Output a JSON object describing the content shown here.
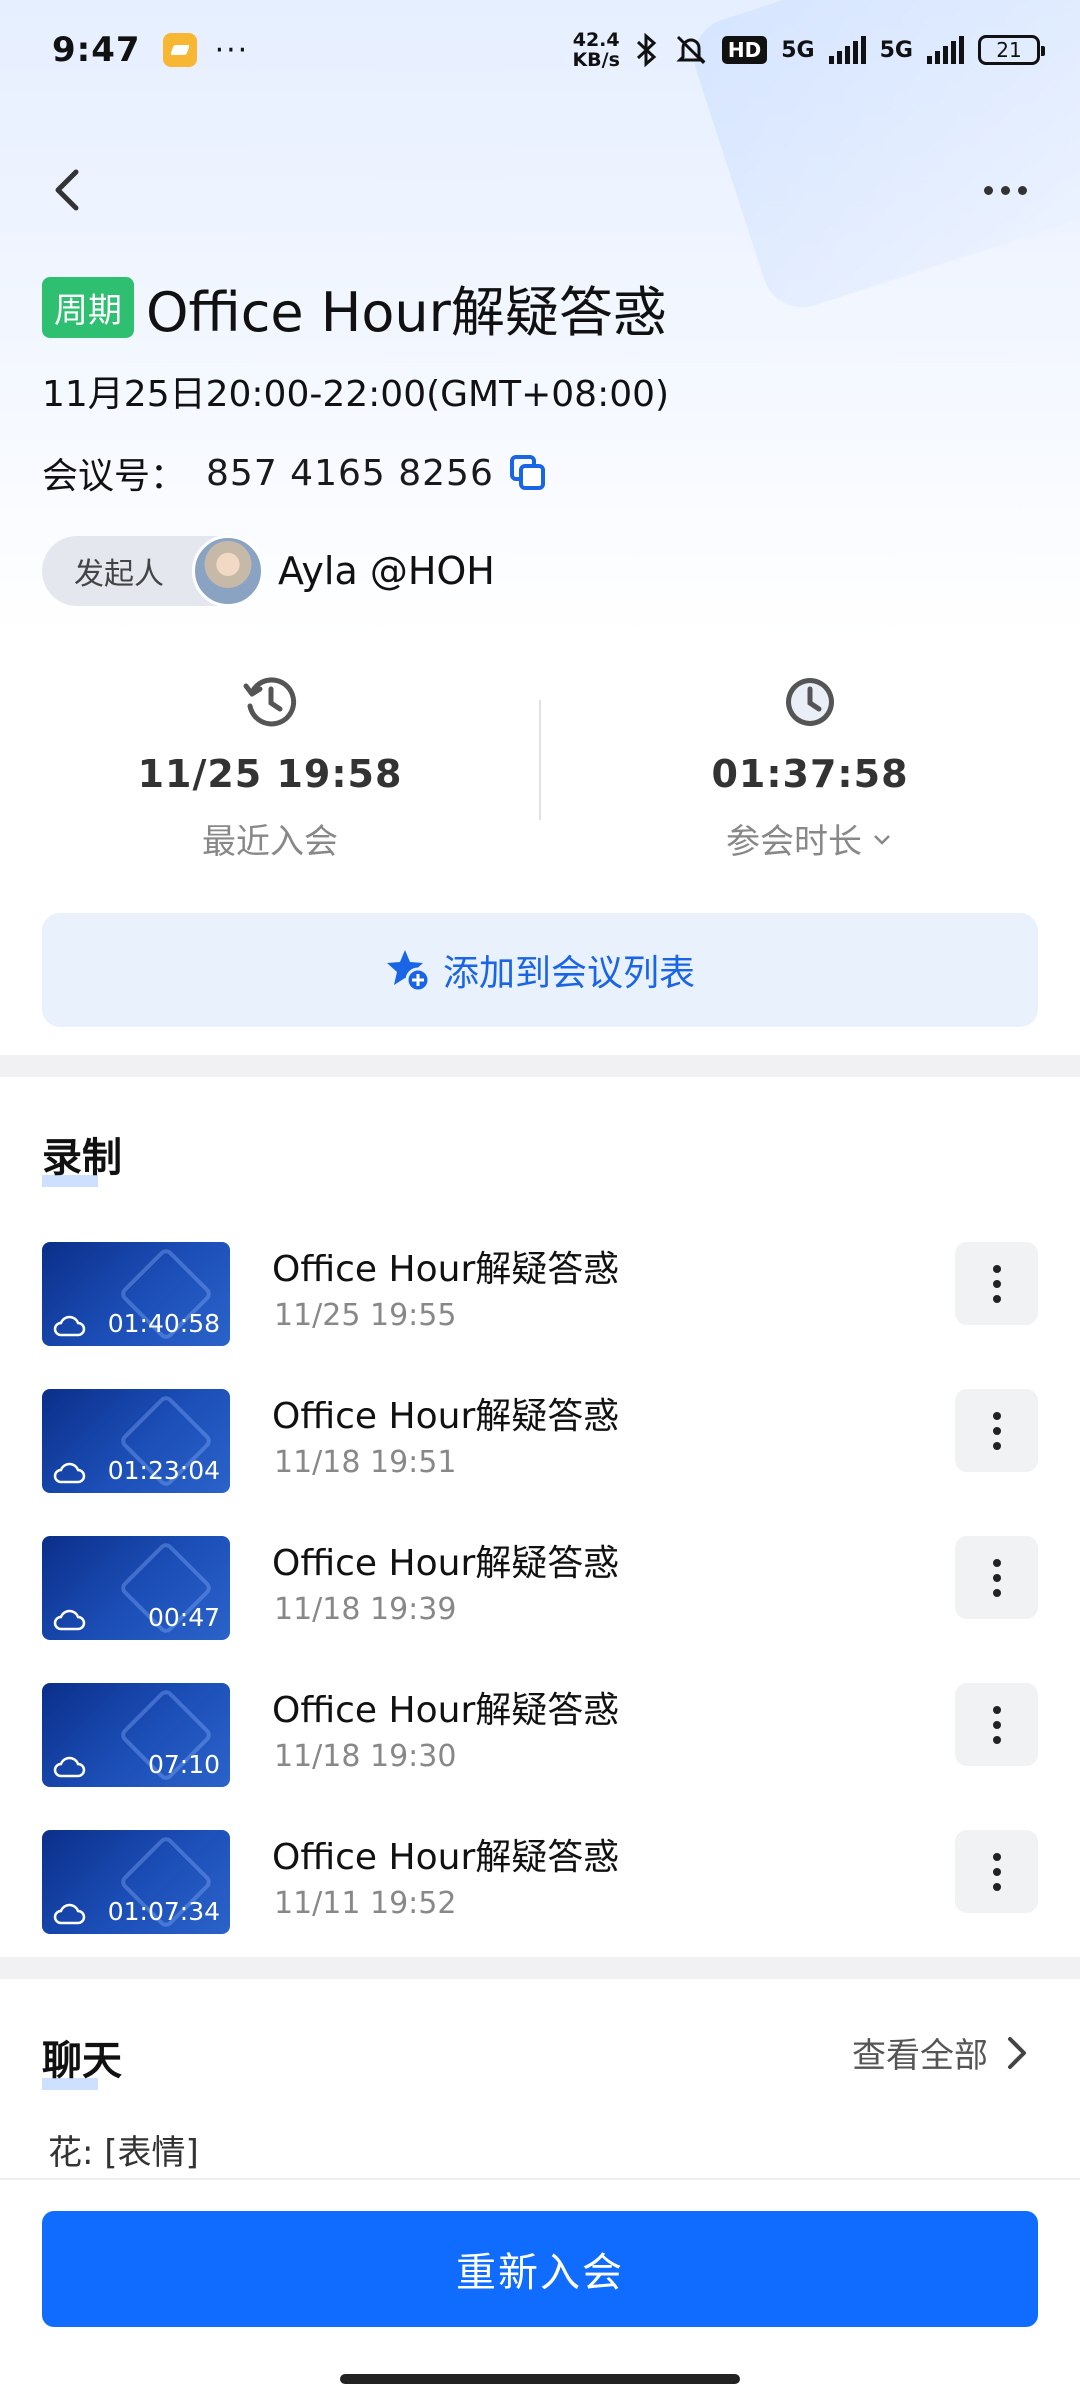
{
  "status": {
    "time": "9:47",
    "dots": "···",
    "speed_value": "42.4",
    "speed_unit": "KB/s",
    "hd": "HD",
    "net1": "5G",
    "net2": "5G",
    "battery": "21"
  },
  "header": {
    "tag": "周期",
    "title": "Office Hour解疑答惑",
    "time_range": "11月25日20:00-22:00(GMT+08:00)",
    "meeting_label": "会议号：",
    "meeting_number": "857 4165 8256",
    "host_label": "发起人",
    "host_name": "Ayla @HOH"
  },
  "stats": {
    "recent_value": "11/25 19:58",
    "recent_label": "最近入会",
    "duration_value": "01:37:58",
    "duration_label": "参会时长"
  },
  "add_button": "添加到会议列表",
  "recordings": {
    "title": "录制",
    "items": [
      {
        "title": "Office Hour解疑答惑",
        "date": "11/25 19:55",
        "duration": "01:40:58"
      },
      {
        "title": "Office Hour解疑答惑",
        "date": "11/18 19:51",
        "duration": "01:23:04"
      },
      {
        "title": "Office Hour解疑答惑",
        "date": "11/18 19:39",
        "duration": "00:47"
      },
      {
        "title": "Office Hour解疑答惑",
        "date": "11/18 19:30",
        "duration": "07:10"
      },
      {
        "title": "Office Hour解疑答惑",
        "date": "11/11 19:52",
        "duration": "01:07:34"
      }
    ]
  },
  "chat": {
    "title": "聊天",
    "view_all": "查看全部",
    "preview": "花: [表情]"
  },
  "rejoin_button": "重新入会",
  "colors": {
    "accent": "#0f6cff",
    "tag_green": "#2fbf71",
    "add_bg": "#e9f1fd"
  }
}
